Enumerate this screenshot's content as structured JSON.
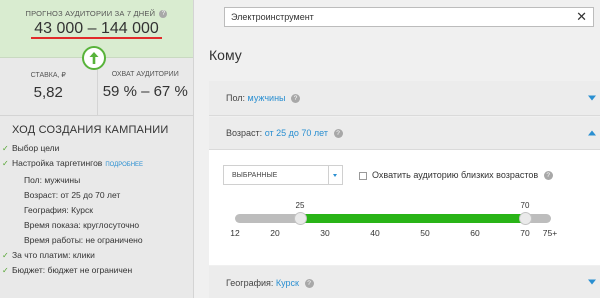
{
  "sidebar": {
    "forecast_label": "ПРОГНОЗ АУДИТОРИИ ЗА 7 ДНЕЙ",
    "forecast_range": "43 000 – 144 000",
    "bid_label": "СТАВКА, ₽",
    "bid_value": "5,82",
    "coverage_label": "ОХВАТ АУДИТОРИИ",
    "coverage_value": "59 % – 67 %",
    "steps_title": "ХОД СОЗДАНИЯ КАМПАНИИ",
    "steps": {
      "goal": "Выбор цели",
      "targeting": "Настройка таргетингов",
      "targeting_more": "ПОДРОБНЕЕ",
      "sex": "Пол: мужчины",
      "age": "Возраст: от 25 до 70 лет",
      "geo": "География: Курск",
      "show_time": "Время показа: круглосуточно",
      "work_time": "Время работы: не ограничено",
      "pay": "За что платим: клики",
      "budget": "Бюджет: бюджет не ограничен"
    }
  },
  "main": {
    "search_value": "Электроинструмент",
    "section_title": "Кому",
    "sex_label": "Пол:",
    "sex_value": "мужчины",
    "age_label": "Возраст:",
    "age_value": "от 25 до 70 лет",
    "age_select": "ВЫБРАННЫЕ",
    "age_checkbox_label": "Охватить аудиторию близких возрастов",
    "slider": {
      "min": 12,
      "max": 75,
      "low": 25,
      "high": 70,
      "low_label": "25",
      "high_label": "70",
      "ticks": [
        "12",
        "20",
        "30",
        "40",
        "50",
        "60",
        "70",
        "75+"
      ]
    },
    "geo_label": "География:",
    "geo_value": "Курск"
  },
  "colors": {
    "forecast_bg": "#d9ecd0",
    "accent_blue": "#2a8fd1",
    "slider_green": "#29b417",
    "underline_red": "#e12b2b"
  }
}
